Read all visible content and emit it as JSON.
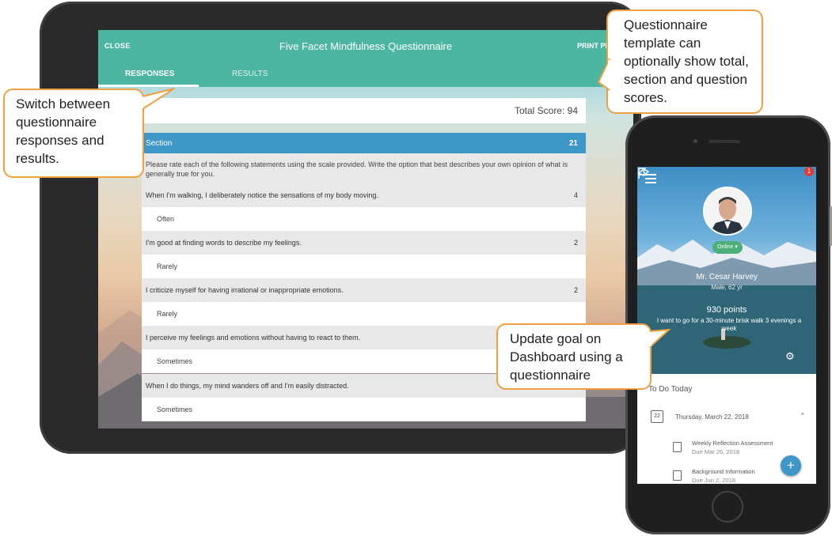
{
  "tablet": {
    "header": {
      "close_label": "CLOSE",
      "title": "Five Facet Mindfulness Questionnaire",
      "print_label": "PRINT PR"
    },
    "tabs": [
      {
        "label": "RESPONSES",
        "active": true
      },
      {
        "label": "RESULTS",
        "active": false
      }
    ],
    "total_score": "Total Score: 94",
    "section": {
      "label": "Section",
      "score": "21"
    },
    "instructions": "Please rate each of the following statements using the scale provided. Write the option that best describes your own opinion of what is generally true for you.",
    "questions": [
      {
        "text": "When I'm walking, I deliberately notice the sensations of my body moving.",
        "score": "4",
        "answer": "Often"
      },
      {
        "text": "I'm good at finding words to describe my feelings.",
        "score": "2",
        "answer": "Rarely"
      },
      {
        "text": "I criticize myself for having irrational or inappropriate emotions.",
        "score": "2",
        "answer": "Rarely"
      },
      {
        "text": "I perceive my feelings and emotions without having to react to them.",
        "score": "",
        "answer": "Sometimes"
      },
      {
        "text": "When I do things, my mind wanders off and I'm easily distracted.",
        "score": "",
        "answer": "Sometimes"
      }
    ],
    "colors": {
      "header": "#4db6a0",
      "section": "#3f97c9"
    }
  },
  "phone": {
    "notification_count": "1",
    "status": "Online",
    "name": "Mr. Cesar Harvey",
    "subtitle": "Male, 62 yr",
    "points": "930 points",
    "goal": "I want to go for a 30-minute brisk walk 3 evenings a week",
    "todo_title": "To Do Today",
    "date_day": "22",
    "date_label": "Thursday, March 22, 2018",
    "tasks": [
      {
        "title": "Weekly Reflection Assessment",
        "due": "Due Mar 26, 2018"
      },
      {
        "title": "Background Information",
        "due": "Due Jun 2, 2018"
      }
    ],
    "fab_label": "+"
  },
  "callouts": {
    "switch": "Switch between questionnaire responses and results.",
    "template": "Questionnaire template can optionally show total, section and question scores.",
    "goal": "Update goal on Dashboard using a questionnaire"
  }
}
